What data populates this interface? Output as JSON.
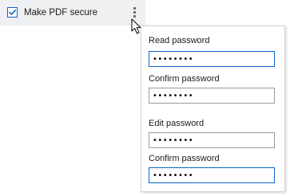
{
  "secure_option": {
    "label": "Make PDF secure",
    "checked": true
  },
  "password_popup": {
    "read_password": {
      "label": "Read password",
      "value": "••••••••"
    },
    "read_confirm": {
      "label": "Confirm password",
      "value": "••••••••"
    },
    "edit_password": {
      "label": "Edit password",
      "value": "••••••••"
    },
    "edit_confirm": {
      "label": "Confirm password",
      "value": "••••••••"
    }
  },
  "colors": {
    "accent": "#0a64c8",
    "row_background": "#eef0f2",
    "input_border": "#9a9a9a"
  },
  "icons": [
    "checkmark-icon",
    "more-options-icon",
    "mouse-cursor-icon"
  ]
}
